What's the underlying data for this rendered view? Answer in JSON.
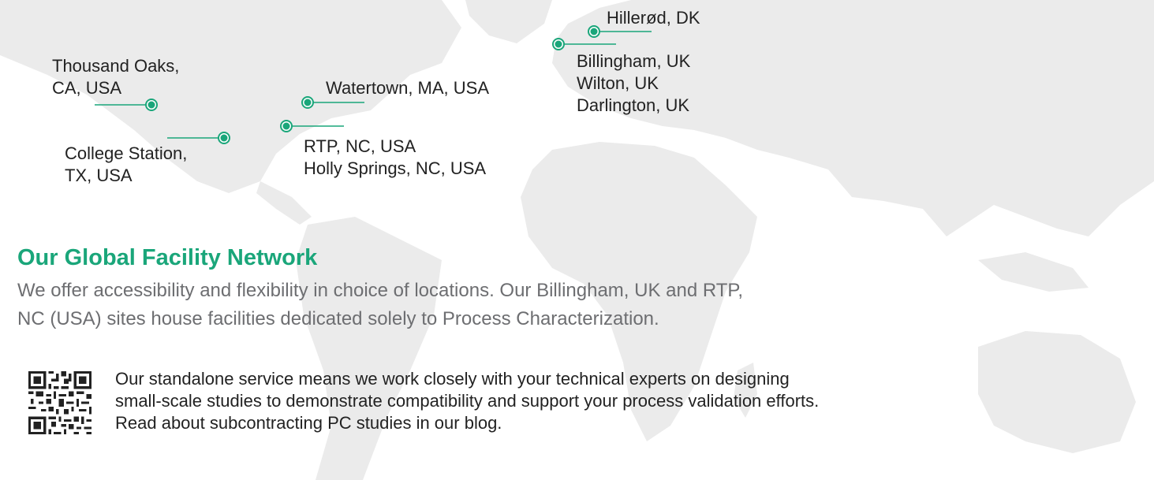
{
  "colors": {
    "accent": "#1aa67a",
    "text": "#222222",
    "muted": "#6d6e71",
    "land": "#ebebeb"
  },
  "locations": {
    "thousand_oaks": [
      "Thousand Oaks,",
      "CA, USA"
    ],
    "college_station": [
      "College Station,",
      "TX, USA"
    ],
    "watertown": "Watertown, MA, USA",
    "rtp": [
      "RTP, NC, USA",
      "Holly Springs, NC, USA"
    ],
    "hillerod": "Hillerød, DK",
    "uk": [
      "Billingham, UK",
      "Wilton, UK",
      "Darlington, UK"
    ]
  },
  "section": {
    "title": "Our Global Facility Network",
    "intro": [
      "We offer accessibility and flexibility in choice of locations. Our Billingham, UK and RTP,",
      "NC (USA) sites house facilities dedicated solely to Process Characterization."
    ]
  },
  "service": {
    "qr_icon": "qr-code-icon",
    "lines": [
      "Our standalone service means we work closely with your technical experts on designing",
      "small-scale studies to demonstrate compatibility and support your process validation efforts.",
      "Read about subcontracting PC studies in our blog."
    ]
  }
}
